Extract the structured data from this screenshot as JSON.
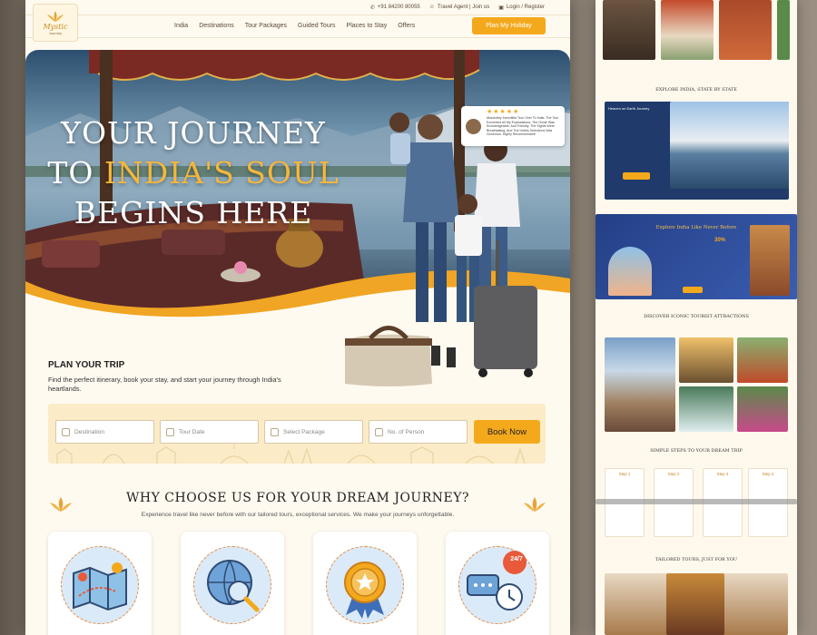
{
  "topbar": {
    "phone": "+91 84200 80055",
    "travel_agent": "Travel Agent | Join us",
    "login": "Login / Register"
  },
  "logo": {
    "text": "Mystic",
    "sub": "Journey"
  },
  "nav": {
    "links": [
      "India",
      "Destinations",
      "Tour Packages",
      "Guided Tours",
      "Places to Stay",
      "Offers"
    ],
    "cta": "Plan My Holiday"
  },
  "hero": {
    "line1": "YOUR JOURNEY",
    "line2_prefix": "TO ",
    "line2_highlight": "INDIA'S SOUL",
    "line3": "BEGINS HERE",
    "review": {
      "stars": "★★★★★",
      "text": "Absolutely Incredible Tour Over To India. The Tour Exceeded All My Expectations. The Guide Was Knowledgeable, And Friendly. The Sights Were Breathtaking, And The Hotels Selections Was Generous. Highly Recommended!"
    }
  },
  "plan": {
    "title": "PLAN YOUR TRIP",
    "description": "Find the perfect itinerary, book your stay, and start your journey through India's heartlands.",
    "fields": [
      {
        "placeholder": "Destination",
        "icon": "map-pin-icon"
      },
      {
        "placeholder": "Tour Date",
        "icon": "calendar-icon"
      },
      {
        "placeholder": "Select Package",
        "icon": "package-icon"
      },
      {
        "placeholder": "No. of Person",
        "icon": "person-icon"
      }
    ],
    "button": "Book Now"
  },
  "why": {
    "title": "WHY CHOOSE US FOR YOUR DREAM JOURNEY?",
    "subtitle": "Experience travel like never before with our tailored tours, exceptional services. We make your journeys unforgettable.",
    "cards": [
      {
        "icon": "map-icon"
      },
      {
        "icon": "globe-search-icon"
      },
      {
        "icon": "award-badge-icon"
      },
      {
        "icon": "support-24-7-icon",
        "badge": "24/7"
      }
    ]
  },
  "preview": {
    "explore_state": "EXPLORE INDIA, STATE BY STATE",
    "heaven": "Heaven on Earth Journey",
    "explore_like": "Explore India Like Never Before",
    "discover": "DISCOVER ICONIC TOURIST ATTRACTIONS",
    "steps_title": "SIMPLE STEPS TO YOUR DREAM TRIP",
    "steps": [
      "Step 1",
      "Step 2",
      "Step 3",
      "Step 4"
    ],
    "tailored": "TAILORED TOURS, JUST FOR YOU",
    "discount": "30%"
  },
  "colors": {
    "accent": "#f4a91c",
    "cream": "#fffaf0",
    "navy": "#1f3a6b"
  }
}
